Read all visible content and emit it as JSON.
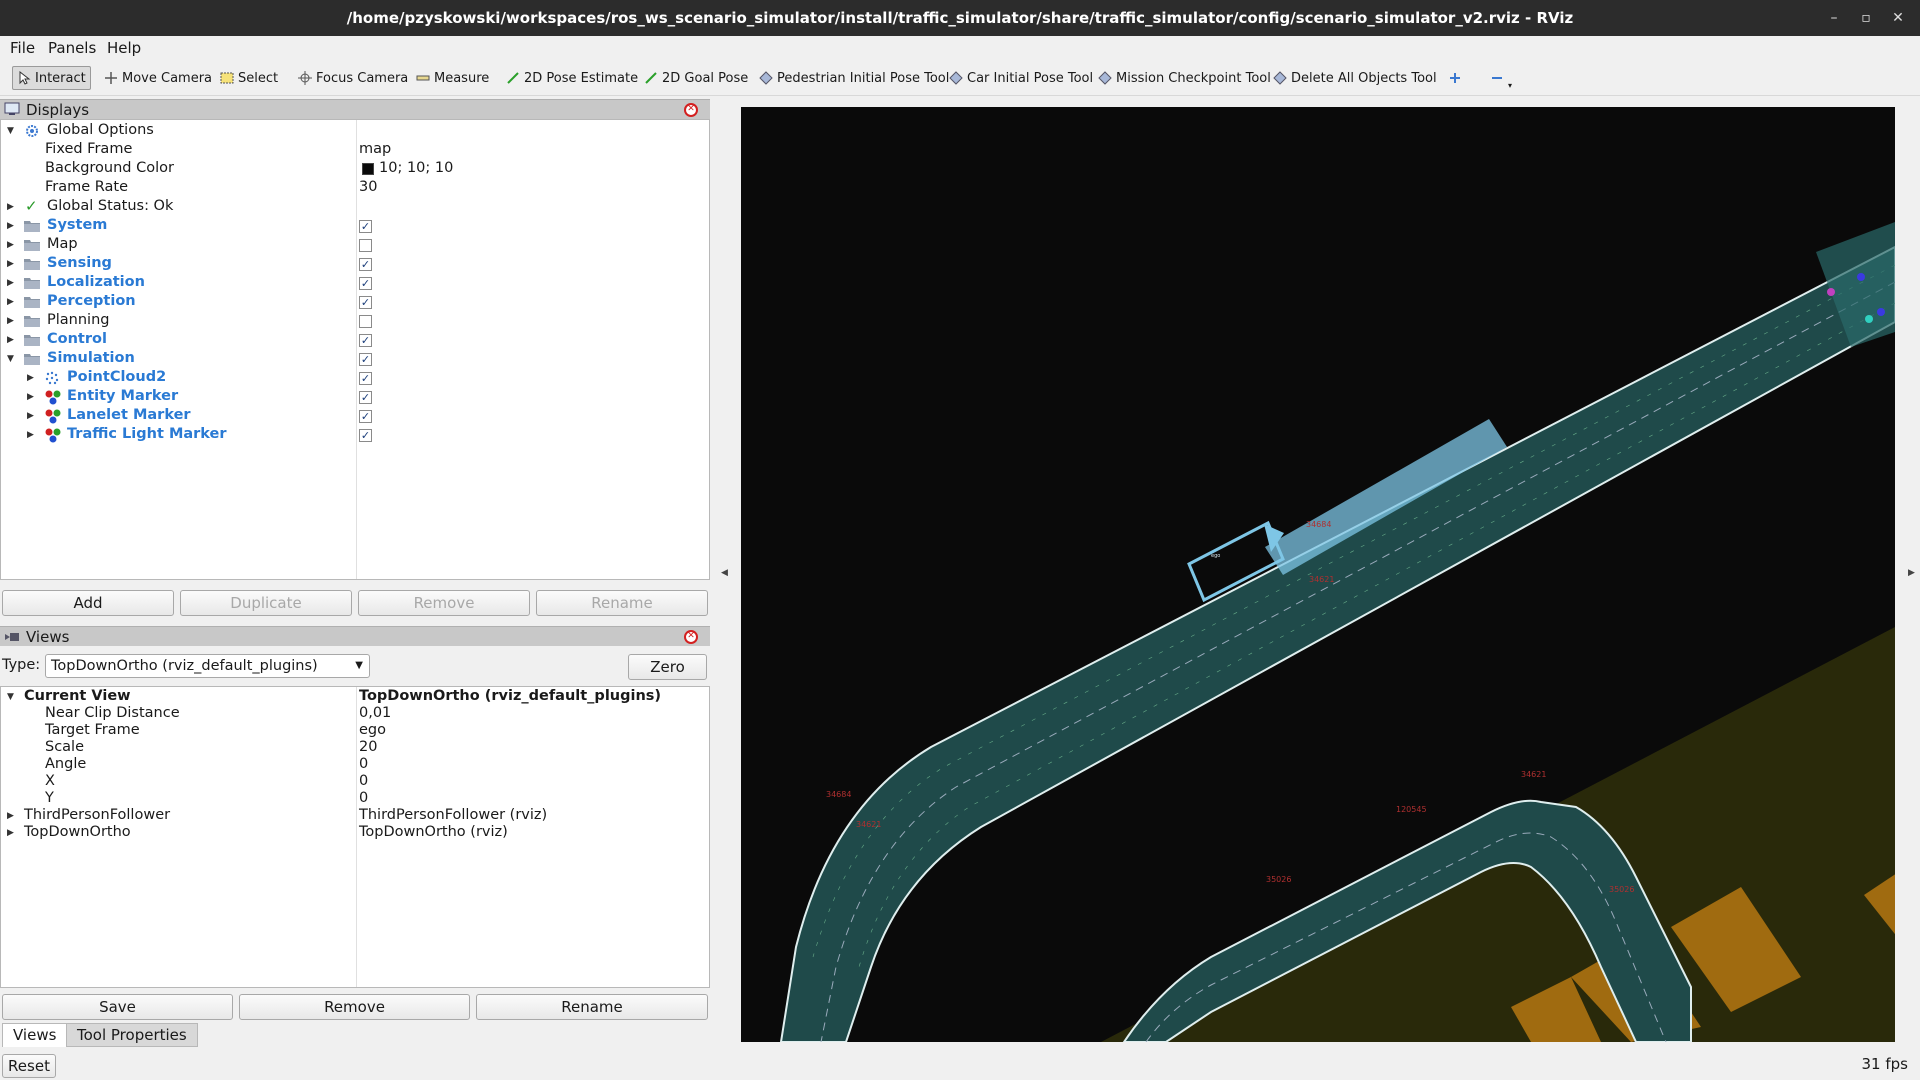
{
  "window": {
    "title": "/home/pzyskowski/workspaces/ros_ws_scenario_simulator/install/traffic_simulator/share/traffic_simulator/config/scenario_simulator_v2.rviz - RViz"
  },
  "menu": {
    "file": "File",
    "panels": "Panels",
    "help": "Help"
  },
  "toolbar": {
    "interact": "Interact",
    "move_camera": "Move Camera",
    "select": "Select",
    "focus_camera": "Focus Camera",
    "measure": "Measure",
    "pose_estimate": "2D Pose Estimate",
    "goal_pose": "2D Goal Pose",
    "pedestrian_pose": "Pedestrian Initial Pose Tool",
    "car_pose": "Car Initial Pose Tool",
    "mission_checkpoint": "Mission Checkpoint Tool",
    "delete_all": "Delete All Objects Tool"
  },
  "displays": {
    "title": "Displays",
    "global_options": "Global Options",
    "fixed_frame_label": "Fixed Frame",
    "fixed_frame_value": "map",
    "bg_color_label": "Background Color",
    "bg_color_value": "10; 10; 10",
    "bg_color_swatch": "#0a0a0a",
    "frame_rate_label": "Frame Rate",
    "frame_rate_value": "30",
    "global_status": "Global Status: Ok",
    "items": [
      {
        "label": "System",
        "checked": true,
        "bold": true
      },
      {
        "label": "Map",
        "checked": false,
        "bold": false
      },
      {
        "label": "Sensing",
        "checked": true,
        "bold": true
      },
      {
        "label": "Localization",
        "checked": true,
        "bold": true
      },
      {
        "label": "Perception",
        "checked": true,
        "bold": true
      },
      {
        "label": "Planning",
        "checked": false,
        "bold": false
      },
      {
        "label": "Control",
        "checked": true,
        "bold": true
      },
      {
        "label": "Simulation",
        "checked": true,
        "bold": true
      }
    ],
    "sim_children": [
      {
        "label": "PointCloud2",
        "checked": true,
        "icon": "pointcloud-icon"
      },
      {
        "label": "Entity Marker",
        "checked": true,
        "icon": "marker-icon"
      },
      {
        "label": "Lanelet Marker",
        "checked": true,
        "icon": "marker-icon"
      },
      {
        "label": "Traffic Light Marker",
        "checked": true,
        "icon": "marker-icon"
      }
    ],
    "buttons": {
      "add": "Add",
      "duplicate": "Duplicate",
      "remove": "Remove",
      "rename": "Rename"
    }
  },
  "views": {
    "title": "Views",
    "type_label": "Type:",
    "type_value": "TopDownOrtho (rviz_default_plugins)",
    "zero": "Zero",
    "current_view_label": "Current View",
    "current_view_value": "TopDownOrtho (rviz_default_plugins)",
    "props": [
      {
        "label": "Near Clip Distance",
        "value": "0,01"
      },
      {
        "label": "Target Frame",
        "value": "ego"
      },
      {
        "label": "Scale",
        "value": "20"
      },
      {
        "label": "Angle",
        "value": "0"
      },
      {
        "label": "X",
        "value": "0"
      },
      {
        "label": "Y",
        "value": "0"
      }
    ],
    "third_person_label": "ThirdPersonFollower",
    "third_person_value": "ThirdPersonFollower (rviz)",
    "topdown_label": "TopDownOrtho",
    "topdown_value": "TopDownOrtho (rviz)",
    "buttons": {
      "save": "Save",
      "remove": "Remove",
      "rename": "Rename"
    }
  },
  "tabs": {
    "views": "Views",
    "tool_properties": "Tool Properties"
  },
  "reset": "Reset",
  "fps": "31 fps",
  "colors": {
    "lane_fill": "#1f4a4a",
    "lane_border": "#dfeeee",
    "ego_box": "#7ec6e6",
    "zone_fill": "#2a2a08",
    "building": "#a06b10"
  }
}
